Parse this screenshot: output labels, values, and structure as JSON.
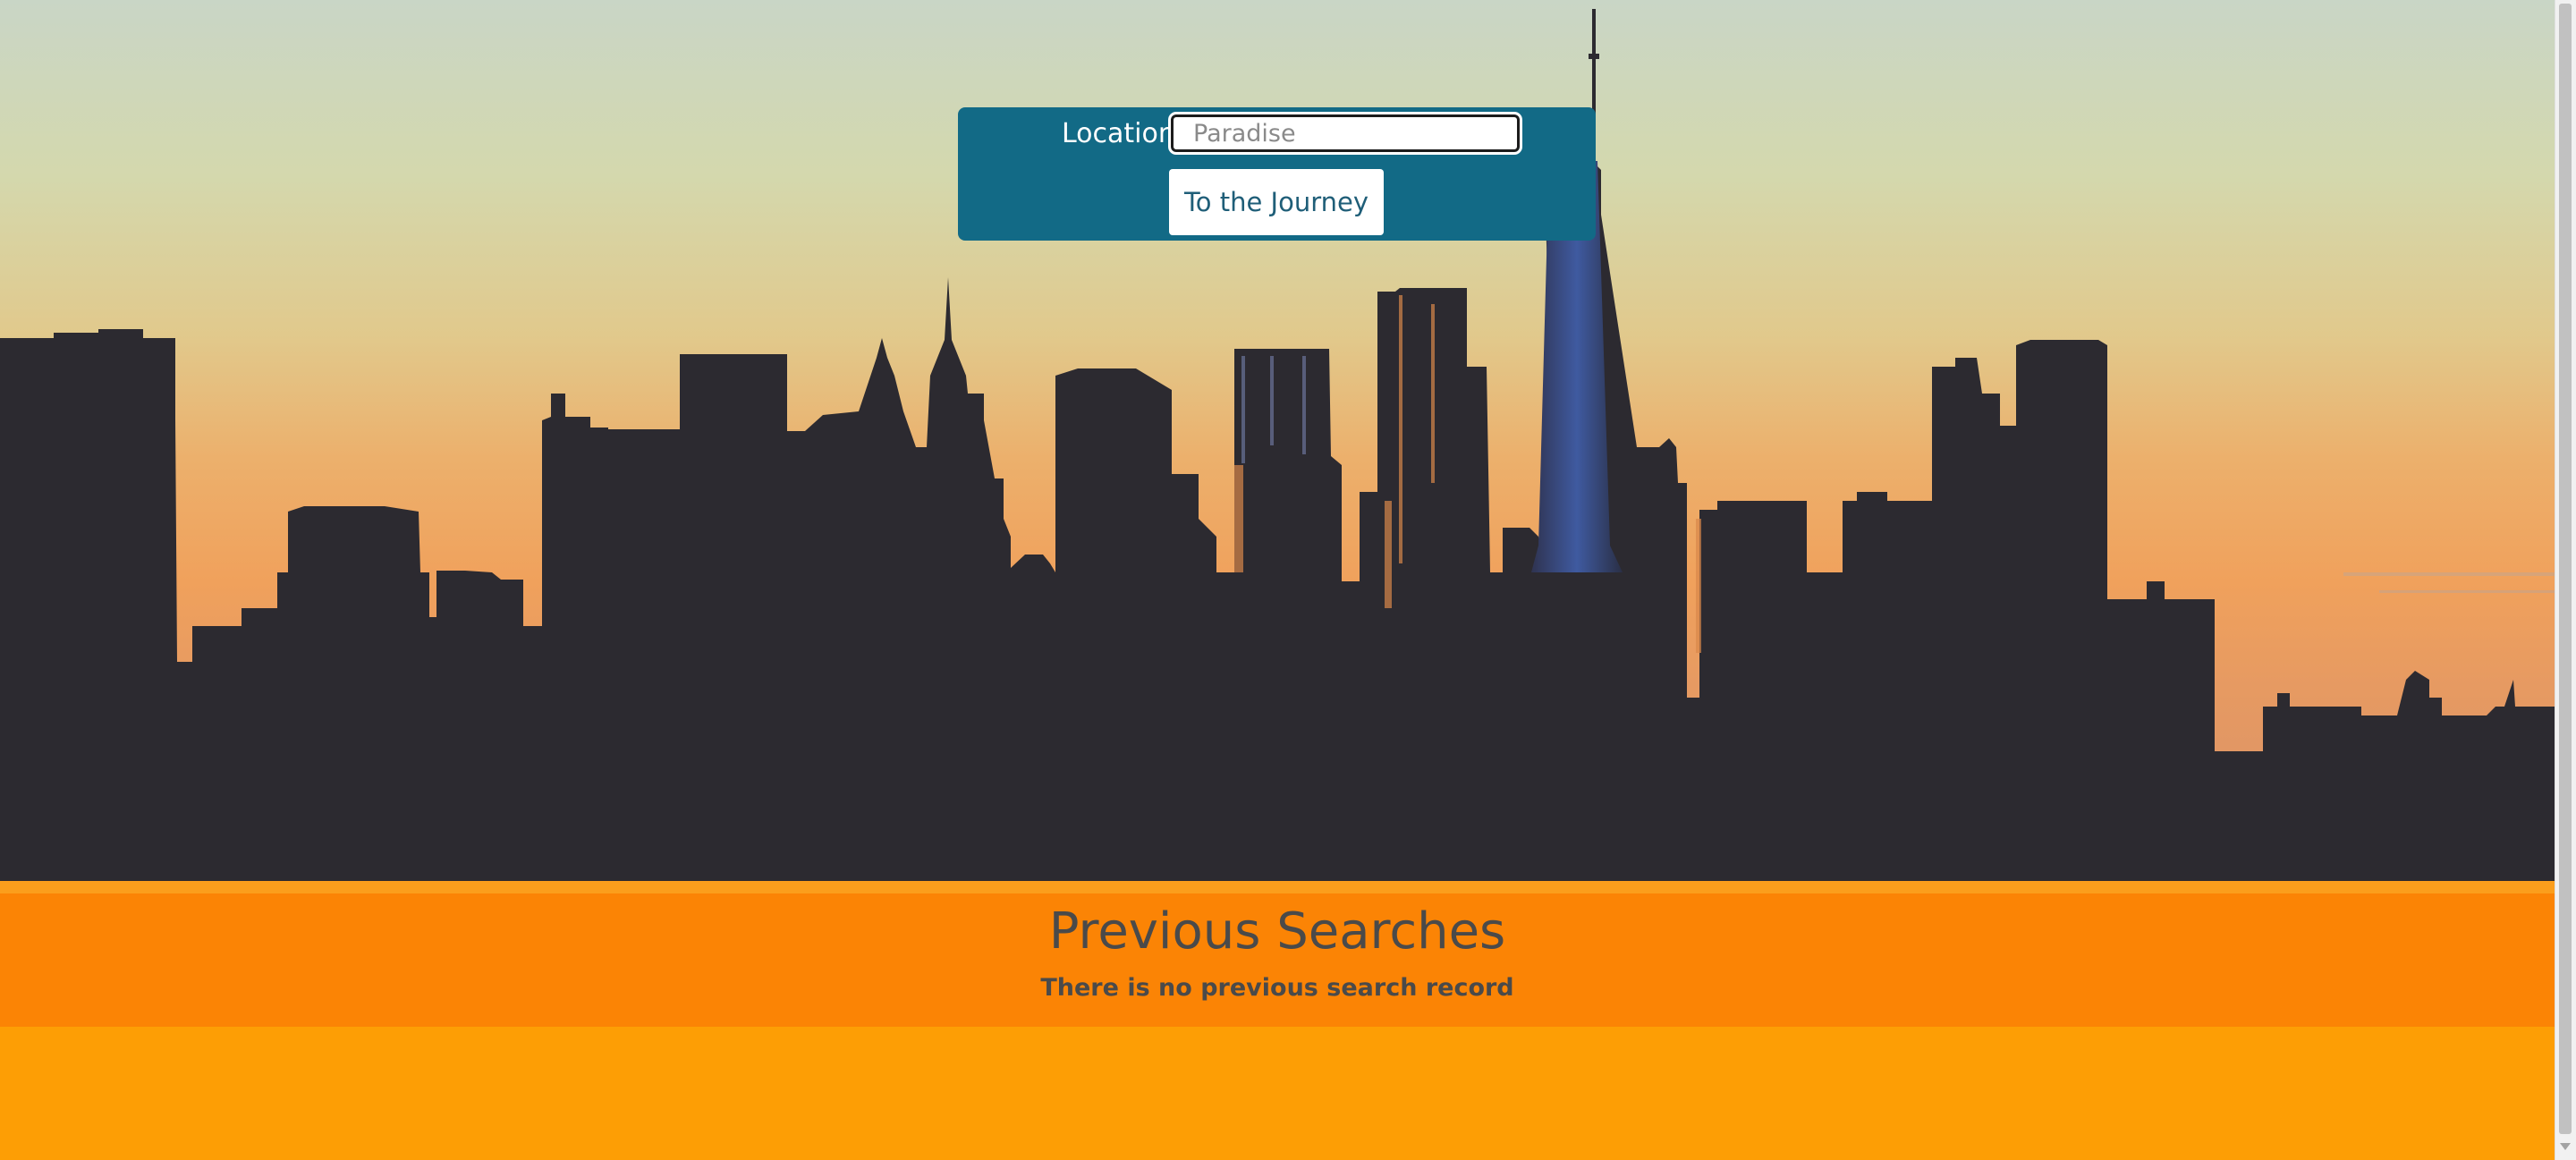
{
  "search": {
    "label": "Location",
    "placeholder": "Paradise",
    "value": "",
    "button_label": "To the Journey"
  },
  "history": {
    "title": "Previous Searches",
    "empty_message": "There is no previous search record"
  },
  "colors": {
    "panel": "#126a86",
    "section_orange": "#fb8405",
    "footer_orange": "#fd9e05",
    "text_dark": "#4a4a4a",
    "skyline": "#2c2a30"
  },
  "background": {
    "icon": "city-skyline-sunset"
  }
}
